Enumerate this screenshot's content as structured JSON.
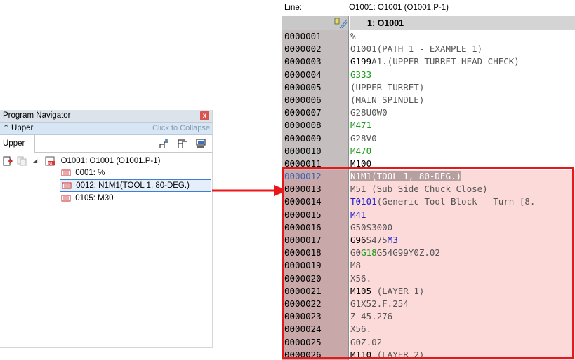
{
  "navigator": {
    "title": "Program Navigator",
    "close_glyph": "x",
    "section_label": "Upper",
    "collapse_hint": "Click to Collapse",
    "tab_label": "Upper",
    "tree": {
      "root_label": "O1001: O1001 (O1001.P-1)",
      "children": [
        {
          "label": "0001: %"
        },
        {
          "label": "0012: N1M1(TOOL 1, 80-DEG.)",
          "selected": true
        },
        {
          "label": "0105: M30"
        }
      ]
    }
  },
  "editor": {
    "line_label": "Line:",
    "line_value": "O1001: O1001 (O1001.P-1)",
    "tab_title": "1: O1001",
    "rows": [
      {
        "num": "0000001",
        "code": "%",
        "seg": [
          {
            "t": "%",
            "c": "n"
          }
        ]
      },
      {
        "num": "0000002",
        "code": "O1001(PATH 1 - EXAMPLE 1)",
        "seg": [
          {
            "t": "O1001(PATH 1 - EXAMPLE 1)",
            "c": "n"
          }
        ]
      },
      {
        "num": "0000003",
        "code": "G199A1.(UPPER TURRET HEAD CHECK)",
        "seg": [
          {
            "t": "G199",
            "c": "k"
          },
          {
            "t": "A1.(UPPER TURRET HEAD CHECK)",
            "c": "n"
          }
        ]
      },
      {
        "num": "0000004",
        "code": "G333",
        "seg": [
          {
            "t": "G333",
            "c": "g"
          }
        ]
      },
      {
        "num": "0000005",
        "code": "(UPPER TURRET)",
        "seg": [
          {
            "t": "(UPPER TURRET)",
            "c": "n"
          }
        ]
      },
      {
        "num": "0000006",
        "code": "(MAIN SPINDLE)",
        "seg": [
          {
            "t": "(MAIN SPINDLE)",
            "c": "n"
          }
        ]
      },
      {
        "num": "0000007",
        "code": "G28U0W0",
        "seg": [
          {
            "t": "G28U0W0",
            "c": "n"
          }
        ]
      },
      {
        "num": "0000008",
        "code": "M471",
        "seg": [
          {
            "t": "M471",
            "c": "g"
          }
        ]
      },
      {
        "num": "0000009",
        "code": "G28V0",
        "seg": [
          {
            "t": "G28V0",
            "c": "n"
          }
        ]
      },
      {
        "num": "0000010",
        "code": "M470",
        "seg": [
          {
            "t": "M470",
            "c": "g"
          }
        ]
      },
      {
        "num": "0000011",
        "code": "M100",
        "seg": [
          {
            "t": "M100",
            "c": "k"
          }
        ]
      },
      {
        "num": "0000012",
        "code": "N1M1(TOOL 1, 80-DEG.)",
        "current": true,
        "seg": [
          {
            "t": "N1M1(TOOL 1, 80-DEG.)",
            "c": "sel"
          }
        ]
      },
      {
        "num": "0000013",
        "code": "M51 (Sub Side Chuck Close)",
        "seg": [
          {
            "t": "M51 (Sub Side Chuck Close)",
            "c": "n"
          }
        ]
      },
      {
        "num": "0000014",
        "code": "T0101(Generic Tool Block - Turn [8.",
        "seg": [
          {
            "t": "T0101",
            "c": "b"
          },
          {
            "t": "(Generic Tool Block - Turn [8.",
            "c": "n"
          }
        ]
      },
      {
        "num": "0000015",
        "code": "M41",
        "seg": [
          {
            "t": "M41",
            "c": "b"
          }
        ]
      },
      {
        "num": "0000016",
        "code": "G50S3000",
        "seg": [
          {
            "t": "G50S3000",
            "c": "n"
          }
        ]
      },
      {
        "num": "0000017",
        "code": "G96S475M3",
        "seg": [
          {
            "t": "G96",
            "c": "k"
          },
          {
            "t": "S475",
            "c": "n"
          },
          {
            "t": "M3",
            "c": "b"
          }
        ]
      },
      {
        "num": "0000018",
        "code": "G0G18G54G99Y0Z.02",
        "seg": [
          {
            "t": "G0",
            "c": "n"
          },
          {
            "t": "G18",
            "c": "g"
          },
          {
            "t": "G54G99Y0Z.02",
            "c": "n"
          }
        ]
      },
      {
        "num": "0000019",
        "code": "M8",
        "seg": [
          {
            "t": "M8",
            "c": "n"
          }
        ]
      },
      {
        "num": "0000020",
        "code": "X56.",
        "seg": [
          {
            "t": "X56.",
            "c": "n"
          }
        ]
      },
      {
        "num": "0000021",
        "code": "M105 (LAYER 1)",
        "seg": [
          {
            "t": "M105",
            "c": "k"
          },
          {
            "t": " (LAYER 1)",
            "c": "n"
          }
        ]
      },
      {
        "num": "0000022",
        "code": "G1X52.F.254",
        "seg": [
          {
            "t": "G1X52.F.254",
            "c": "n"
          }
        ]
      },
      {
        "num": "0000023",
        "code": "Z-45.276",
        "seg": [
          {
            "t": "Z-45.276",
            "c": "n"
          }
        ]
      },
      {
        "num": "0000024",
        "code": "X56.",
        "seg": [
          {
            "t": "X56.",
            "c": "n"
          }
        ]
      },
      {
        "num": "0000025",
        "code": "G0Z.02",
        "seg": [
          {
            "t": "G0Z.02",
            "c": "n"
          }
        ]
      },
      {
        "num": "0000026",
        "code": "M110 (LAYER 2)",
        "seg": [
          {
            "t": "M110",
            "c": "k"
          },
          {
            "t": " (LAYER 2)",
            "c": "n"
          }
        ]
      }
    ],
    "highlight_from_row": "0000012"
  },
  "colors": {
    "highlight_border": "#e8171a",
    "highlight_fill": "#fcdada",
    "selection": "#b59f9f",
    "green_code": "#1a9a1a",
    "blue_code": "#2222c8"
  }
}
